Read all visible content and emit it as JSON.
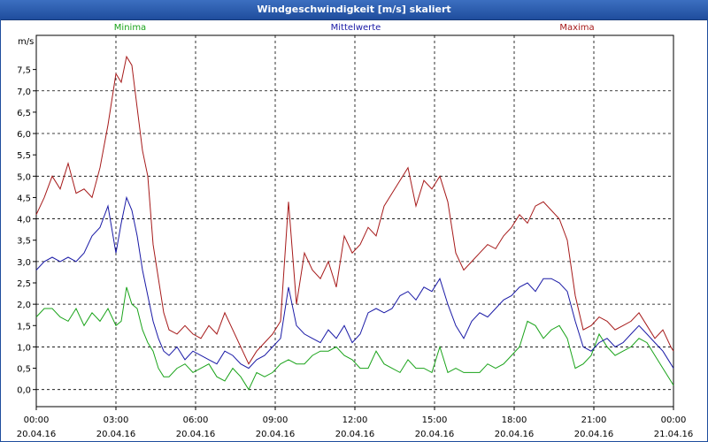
{
  "chart_data": {
    "type": "line",
    "title": "Windgeschwindigkeit [m/s] skaliert",
    "ylabel": "m/s",
    "xlabel": "",
    "ylim": [
      -0.4,
      8.3
    ],
    "xlim": [
      0,
      24
    ],
    "grid": true,
    "y_ticks": [
      "0,0",
      "0,5",
      "1,0",
      "1,5",
      "2,0",
      "2,5",
      "3,0",
      "3,5",
      "4,0",
      "4,5",
      "5,0",
      "5,5",
      "6,0",
      "6,5",
      "7,0",
      "7,5"
    ],
    "x_ticks": [
      {
        "time": "00:00",
        "date": "20.04.16"
      },
      {
        "time": "03:00",
        "date": "20.04.16"
      },
      {
        "time": "06:00",
        "date": "20.04.16"
      },
      {
        "time": "09:00",
        "date": "20.04.16"
      },
      {
        "time": "12:00",
        "date": "20.04.16"
      },
      {
        "time": "15:00",
        "date": "20.04.16"
      },
      {
        "time": "18:00",
        "date": "20.04.16"
      },
      {
        "time": "21:00",
        "date": "20.04.16"
      },
      {
        "time": "00:00",
        "date": "21.04.16"
      }
    ],
    "series": [
      {
        "name": "Minima",
        "color": "#1aa31a",
        "points": [
          [
            0,
            1.7
          ],
          [
            0.3,
            1.9
          ],
          [
            0.6,
            1.9
          ],
          [
            0.9,
            1.7
          ],
          [
            1.2,
            1.6
          ],
          [
            1.5,
            1.9
          ],
          [
            1.8,
            1.5
          ],
          [
            2.1,
            1.8
          ],
          [
            2.4,
            1.6
          ],
          [
            2.7,
            1.9
          ],
          [
            3.0,
            1.5
          ],
          [
            3.2,
            1.6
          ],
          [
            3.4,
            2.4
          ],
          [
            3.6,
            2.0
          ],
          [
            3.8,
            1.9
          ],
          [
            4.0,
            1.4
          ],
          [
            4.2,
            1.1
          ],
          [
            4.4,
            0.9
          ],
          [
            4.6,
            0.5
          ],
          [
            4.8,
            0.3
          ],
          [
            5.0,
            0.3
          ],
          [
            5.3,
            0.5
          ],
          [
            5.6,
            0.6
          ],
          [
            5.9,
            0.4
          ],
          [
            6.2,
            0.5
          ],
          [
            6.5,
            0.6
          ],
          [
            6.8,
            0.3
          ],
          [
            7.1,
            0.2
          ],
          [
            7.4,
            0.5
          ],
          [
            7.7,
            0.3
          ],
          [
            8.0,
            0.0
          ],
          [
            8.3,
            0.4
          ],
          [
            8.6,
            0.3
          ],
          [
            8.9,
            0.4
          ],
          [
            9.2,
            0.6
          ],
          [
            9.5,
            0.7
          ],
          [
            9.8,
            0.6
          ],
          [
            10.1,
            0.6
          ],
          [
            10.4,
            0.8
          ],
          [
            10.7,
            0.9
          ],
          [
            11.0,
            0.9
          ],
          [
            11.3,
            1.0
          ],
          [
            11.6,
            0.8
          ],
          [
            11.9,
            0.7
          ],
          [
            12.2,
            0.5
          ],
          [
            12.5,
            0.5
          ],
          [
            12.8,
            0.9
          ],
          [
            13.1,
            0.6
          ],
          [
            13.4,
            0.5
          ],
          [
            13.7,
            0.4
          ],
          [
            14.0,
            0.7
          ],
          [
            14.3,
            0.5
          ],
          [
            14.6,
            0.5
          ],
          [
            14.9,
            0.4
          ],
          [
            15.2,
            1.0
          ],
          [
            15.5,
            0.4
          ],
          [
            15.8,
            0.5
          ],
          [
            16.1,
            0.4
          ],
          [
            16.4,
            0.4
          ],
          [
            16.7,
            0.4
          ],
          [
            17.0,
            0.6
          ],
          [
            17.3,
            0.5
          ],
          [
            17.6,
            0.6
          ],
          [
            17.9,
            0.8
          ],
          [
            18.2,
            1.0
          ],
          [
            18.5,
            1.6
          ],
          [
            18.8,
            1.5
          ],
          [
            19.1,
            1.2
          ],
          [
            19.4,
            1.4
          ],
          [
            19.7,
            1.5
          ],
          [
            20.0,
            1.2
          ],
          [
            20.3,
            0.5
          ],
          [
            20.6,
            0.6
          ],
          [
            20.9,
            0.8
          ],
          [
            21.2,
            1.3
          ],
          [
            21.5,
            1.0
          ],
          [
            21.8,
            0.8
          ],
          [
            22.1,
            0.9
          ],
          [
            22.4,
            1.0
          ],
          [
            22.7,
            1.2
          ],
          [
            23.0,
            1.1
          ],
          [
            23.3,
            0.8
          ],
          [
            23.6,
            0.5
          ],
          [
            23.9,
            0.2
          ],
          [
            24.0,
            0.1
          ]
        ]
      },
      {
        "name": "Mittelwerte",
        "color": "#1a1aa6",
        "points": [
          [
            0,
            2.8
          ],
          [
            0.3,
            3.0
          ],
          [
            0.6,
            3.1
          ],
          [
            0.9,
            3.0
          ],
          [
            1.2,
            3.1
          ],
          [
            1.5,
            3.0
          ],
          [
            1.8,
            3.2
          ],
          [
            2.1,
            3.6
          ],
          [
            2.4,
            3.8
          ],
          [
            2.7,
            4.3
          ],
          [
            3.0,
            3.2
          ],
          [
            3.2,
            3.9
          ],
          [
            3.4,
            4.5
          ],
          [
            3.6,
            4.2
          ],
          [
            3.8,
            3.6
          ],
          [
            4.0,
            2.8
          ],
          [
            4.2,
            2.2
          ],
          [
            4.4,
            1.6
          ],
          [
            4.6,
            1.2
          ],
          [
            4.8,
            0.9
          ],
          [
            5.0,
            0.8
          ],
          [
            5.3,
            1.0
          ],
          [
            5.6,
            0.7
          ],
          [
            5.9,
            0.9
          ],
          [
            6.2,
            0.8
          ],
          [
            6.5,
            0.7
          ],
          [
            6.8,
            0.6
          ],
          [
            7.1,
            0.9
          ],
          [
            7.4,
            0.8
          ],
          [
            7.7,
            0.6
          ],
          [
            8.0,
            0.5
          ],
          [
            8.3,
            0.7
          ],
          [
            8.6,
            0.8
          ],
          [
            8.9,
            1.0
          ],
          [
            9.2,
            1.2
          ],
          [
            9.5,
            2.4
          ],
          [
            9.8,
            1.5
          ],
          [
            10.1,
            1.3
          ],
          [
            10.4,
            1.2
          ],
          [
            10.7,
            1.1
          ],
          [
            11.0,
            1.4
          ],
          [
            11.3,
            1.2
          ],
          [
            11.6,
            1.5
          ],
          [
            11.9,
            1.1
          ],
          [
            12.2,
            1.3
          ],
          [
            12.5,
            1.8
          ],
          [
            12.8,
            1.9
          ],
          [
            13.1,
            1.8
          ],
          [
            13.4,
            1.9
          ],
          [
            13.7,
            2.2
          ],
          [
            14.0,
            2.3
          ],
          [
            14.3,
            2.1
          ],
          [
            14.6,
            2.4
          ],
          [
            14.9,
            2.3
          ],
          [
            15.2,
            2.6
          ],
          [
            15.5,
            2.0
          ],
          [
            15.8,
            1.5
          ],
          [
            16.1,
            1.2
          ],
          [
            16.4,
            1.6
          ],
          [
            16.7,
            1.8
          ],
          [
            17.0,
            1.7
          ],
          [
            17.3,
            1.9
          ],
          [
            17.6,
            2.1
          ],
          [
            17.9,
            2.2
          ],
          [
            18.2,
            2.4
          ],
          [
            18.5,
            2.5
          ],
          [
            18.8,
            2.3
          ],
          [
            19.1,
            2.6
          ],
          [
            19.4,
            2.6
          ],
          [
            19.7,
            2.5
          ],
          [
            20.0,
            2.3
          ],
          [
            20.3,
            1.6
          ],
          [
            20.6,
            1.0
          ],
          [
            20.9,
            0.9
          ],
          [
            21.2,
            1.1
          ],
          [
            21.5,
            1.2
          ],
          [
            21.8,
            1.0
          ],
          [
            22.1,
            1.1
          ],
          [
            22.4,
            1.3
          ],
          [
            22.7,
            1.5
          ],
          [
            23.0,
            1.3
          ],
          [
            23.3,
            1.1
          ],
          [
            23.6,
            0.9
          ],
          [
            23.9,
            0.6
          ],
          [
            24.0,
            0.5
          ]
        ]
      },
      {
        "name": "Maxima",
        "color": "#a61a1a",
        "points": [
          [
            0,
            4.1
          ],
          [
            0.3,
            4.5
          ],
          [
            0.6,
            5.0
          ],
          [
            0.9,
            4.7
          ],
          [
            1.2,
            5.3
          ],
          [
            1.5,
            4.6
          ],
          [
            1.8,
            4.7
          ],
          [
            2.1,
            4.5
          ],
          [
            2.4,
            5.2
          ],
          [
            2.7,
            6.2
          ],
          [
            3.0,
            7.4
          ],
          [
            3.2,
            7.2
          ],
          [
            3.4,
            7.8
          ],
          [
            3.6,
            7.6
          ],
          [
            3.8,
            6.6
          ],
          [
            4.0,
            5.6
          ],
          [
            4.2,
            5.0
          ],
          [
            4.4,
            3.4
          ],
          [
            4.6,
            2.6
          ],
          [
            4.8,
            1.8
          ],
          [
            5.0,
            1.4
          ],
          [
            5.3,
            1.3
          ],
          [
            5.6,
            1.5
          ],
          [
            5.9,
            1.3
          ],
          [
            6.2,
            1.2
          ],
          [
            6.5,
            1.5
          ],
          [
            6.8,
            1.3
          ],
          [
            7.1,
            1.8
          ],
          [
            7.4,
            1.4
          ],
          [
            7.7,
            1.0
          ],
          [
            8.0,
            0.6
          ],
          [
            8.3,
            0.9
          ],
          [
            8.6,
            1.1
          ],
          [
            8.9,
            1.3
          ],
          [
            9.2,
            1.6
          ],
          [
            9.5,
            4.4
          ],
          [
            9.8,
            2.0
          ],
          [
            10.1,
            3.2
          ],
          [
            10.4,
            2.8
          ],
          [
            10.7,
            2.6
          ],
          [
            11.0,
            3.0
          ],
          [
            11.3,
            2.4
          ],
          [
            11.6,
            3.6
          ],
          [
            11.9,
            3.2
          ],
          [
            12.2,
            3.4
          ],
          [
            12.5,
            3.8
          ],
          [
            12.8,
            3.6
          ],
          [
            13.1,
            4.3
          ],
          [
            13.4,
            4.6
          ],
          [
            13.7,
            4.9
          ],
          [
            14.0,
            5.2
          ],
          [
            14.3,
            4.3
          ],
          [
            14.6,
            4.9
          ],
          [
            14.9,
            4.7
          ],
          [
            15.2,
            5.0
          ],
          [
            15.5,
            4.4
          ],
          [
            15.8,
            3.2
          ],
          [
            16.1,
            2.8
          ],
          [
            16.4,
            3.0
          ],
          [
            16.7,
            3.2
          ],
          [
            17.0,
            3.4
          ],
          [
            17.3,
            3.3
          ],
          [
            17.6,
            3.6
          ],
          [
            17.9,
            3.8
          ],
          [
            18.2,
            4.1
          ],
          [
            18.5,
            3.9
          ],
          [
            18.8,
            4.3
          ],
          [
            19.1,
            4.4
          ],
          [
            19.7,
            4.0
          ],
          [
            20.0,
            3.5
          ],
          [
            20.3,
            2.2
          ],
          [
            20.6,
            1.4
          ],
          [
            20.9,
            1.5
          ],
          [
            21.2,
            1.7
          ],
          [
            21.5,
            1.6
          ],
          [
            21.8,
            1.4
          ],
          [
            22.1,
            1.5
          ],
          [
            22.4,
            1.6
          ],
          [
            22.7,
            1.8
          ],
          [
            23.0,
            1.5
          ],
          [
            23.3,
            1.2
          ],
          [
            23.6,
            1.4
          ],
          [
            23.9,
            1.0
          ],
          [
            24.0,
            0.9
          ]
        ]
      }
    ]
  }
}
